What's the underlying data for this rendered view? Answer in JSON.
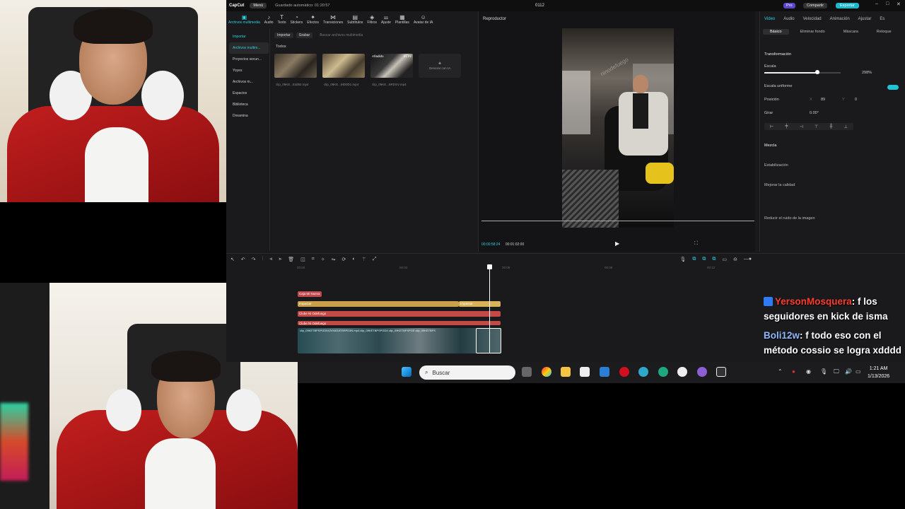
{
  "app": {
    "logo": "CapCut",
    "menu": "Menú",
    "autosave": "Guardado automático: 01:20:57",
    "project": "0112",
    "pro": "Pro",
    "share": "Compartir",
    "export": "Exportar"
  },
  "toolbar": {
    "items": [
      {
        "label": "Archivos multimedia",
        "icon": "media-icon"
      },
      {
        "label": "Audio",
        "icon": "audio-icon"
      },
      {
        "label": "Texto",
        "icon": "text-icon"
      },
      {
        "label": "Stickers",
        "icon": "sticker-icon"
      },
      {
        "label": "Efectos",
        "icon": "effects-icon"
      },
      {
        "label": "Transiciones",
        "icon": "transitions-icon"
      },
      {
        "label": "Subtítulos",
        "icon": "subtitles-icon"
      },
      {
        "label": "Filtros",
        "icon": "filters-icon"
      },
      {
        "label": "Ajuste",
        "icon": "adjust-icon"
      },
      {
        "label": "Plantillas",
        "icon": "templates-icon"
      },
      {
        "label": "Avatar de IA",
        "icon": "avatar-icon"
      }
    ]
  },
  "sidebar": {
    "items": [
      {
        "label": "Importar"
      },
      {
        "label": "Archivos multim..."
      },
      {
        "label": "Proyectos secun..."
      },
      {
        "label": "Yoyes"
      },
      {
        "label": "Archivos m..."
      },
      {
        "label": "Espacios"
      },
      {
        "label": "Biblioteca"
      },
      {
        "label": "Dreamina"
      }
    ]
  },
  "media": {
    "import_btn": "Importar",
    "record_btn": "Grabar",
    "search_placeholder": "Buscar archivos multimedia",
    "filter_all": "Todos",
    "thumbs": [
      {
        "label": "clip_09KE...53d92.mp4"
      },
      {
        "label": "clip_09KE...MD0D1.mp4"
      },
      {
        "label": "clip_09KE...8RDSV.mp4",
        "badge": "Añadido",
        "duration": "01:02"
      }
    ],
    "ai_card": "Generar con IA"
  },
  "player": {
    "title": "Reproductor",
    "watermark": "ninodefuego",
    "time_current": "00:00:58:24",
    "time_total": "00:01:02:00"
  },
  "props": {
    "tabs": [
      "Video",
      "Audio",
      "Velocidad",
      "Animación",
      "Ajustar",
      "Es"
    ],
    "subtabs": [
      "Básico",
      "Eliminar fondo",
      "Máscara",
      "Retoque"
    ],
    "transform": "Transformación",
    "scale_label": "Escala",
    "scale_value": "298%",
    "uniform_scale": "Escala uniforme",
    "position_label": "Posición",
    "pos_x_label": "X",
    "pos_x": "89",
    "pos_y_label": "Y",
    "pos_y": "0",
    "rotate_label": "Girar",
    "rotate_value": "0.00°",
    "blend": "Mezcla",
    "stabilize": "Estabilización",
    "quality": "Mejorar la calidad",
    "denoise": "Reducir el ruido de la imagen"
  },
  "timeline": {
    "ruler": [
      "00:00",
      "00:03",
      "00:06",
      "00:09",
      "00:12"
    ],
    "tracks": [
      {
        "label": "Caja Mi Nueva",
        "color": "#c0494f"
      },
      {
        "label": "Impactar",
        "color": "#c9a14a"
      },
      {
        "label": "Impactar",
        "color": "#c9a14a"
      },
      {
        "label": "Clube Ni Odefuego",
        "color": "#c44a48"
      },
      {
        "label": "Clube Ni Odefuego",
        "color": "#c44a48"
      }
    ],
    "video_label": "clip_09KETBPSPGD042VK6DATBRPD3N.mp4  clip_09KETBPSPGD4  clip_09KETBFSPGE  clip_09KETBFS"
  },
  "taskbar": {
    "search": "Buscar",
    "time": "1:21 AM",
    "date": "1/13/2026"
  },
  "chat": [
    {
      "user": "YersonMosquera",
      "message": ": f los seguidores en kick de isma"
    },
    {
      "user": "Boli12w",
      "message": ": f todo eso con el método cossio se logra xdddd"
    }
  ]
}
